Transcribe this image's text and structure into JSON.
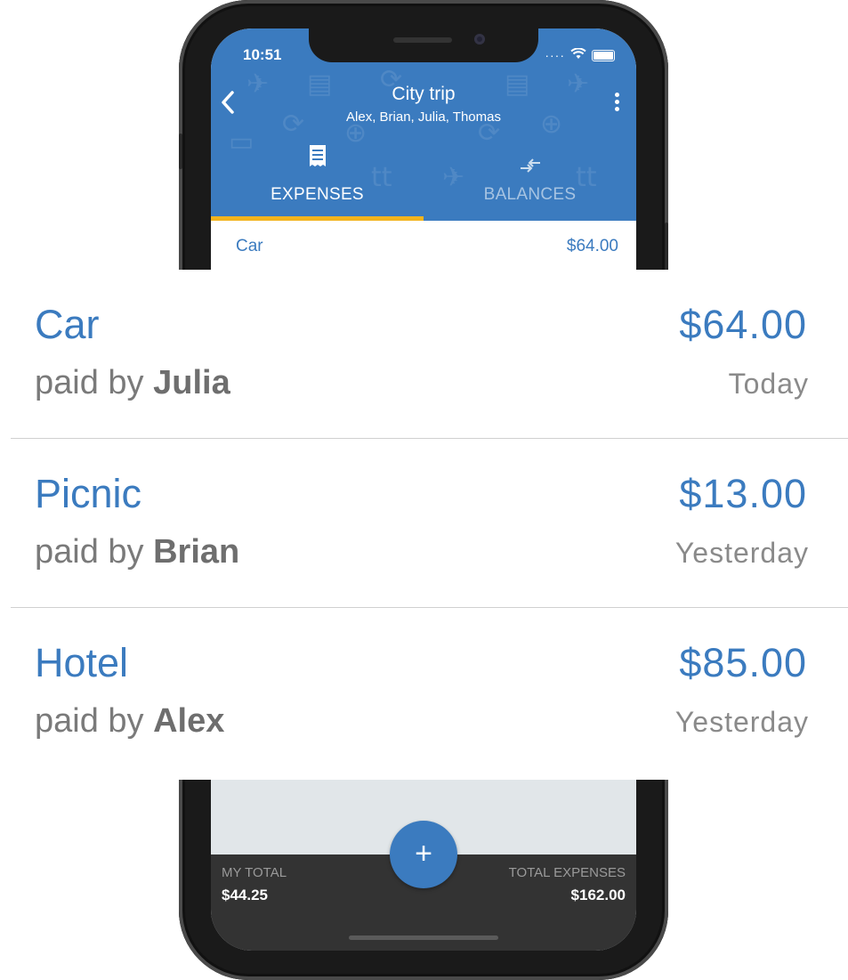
{
  "status_bar": {
    "time": "10:51"
  },
  "header": {
    "back_icon": "chevron-left-icon",
    "title": "City trip",
    "subtitle": "Alex, Brian, Julia, Thomas",
    "more_icon": "more-vert-icon"
  },
  "tabs": [
    {
      "label": "EXPENSES",
      "icon": "receipt-icon",
      "active": true
    },
    {
      "label": "BALANCES",
      "icon": "transfer-arrows-icon",
      "active": false
    }
  ],
  "mini_row": {
    "name": "Car",
    "amount": "$64.00"
  },
  "expenses": [
    {
      "name": "Car",
      "amount": "$64.00",
      "paid_by_prefix": "paid by",
      "payer": "Julia",
      "date": "Today"
    },
    {
      "name": "Picnic",
      "amount": "$13.00",
      "paid_by_prefix": "paid by",
      "payer": "Brian",
      "date": "Yesterday"
    },
    {
      "name": "Hotel",
      "amount": "$85.00",
      "paid_by_prefix": "paid by",
      "payer": "Alex",
      "date": "Yesterday"
    }
  ],
  "footer": {
    "my_total_label": "MY TOTAL",
    "my_total_value": "$44.25",
    "total_expenses_label": "TOTAL EXPENSES",
    "total_expenses_value": "$162.00",
    "fab_icon": "plus-icon",
    "fab_symbol": "+"
  },
  "colors": {
    "primary": "#3b7bbf",
    "tab_indicator": "#f2b41e",
    "footer": "#333333"
  }
}
